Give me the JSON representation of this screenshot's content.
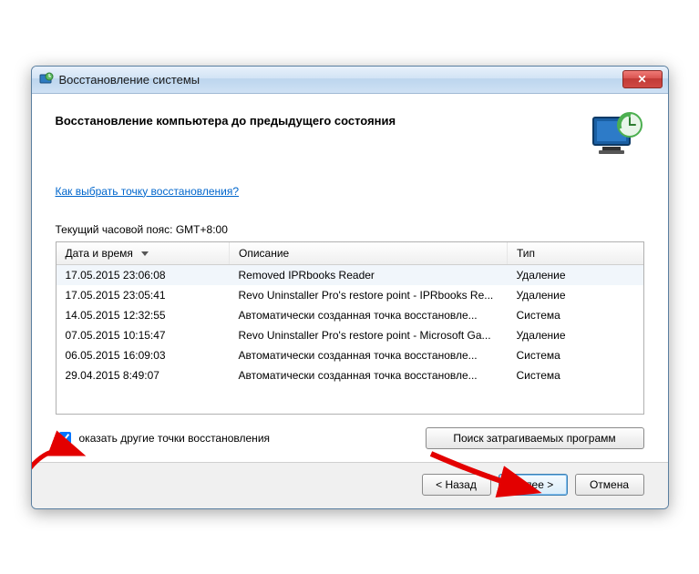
{
  "window": {
    "title": "Восстановление системы"
  },
  "header": {
    "heading": "Восстановление компьютера до предыдущего состояния",
    "help_link": "Как выбрать точку восстановления?",
    "timezone": "Текущий часовой пояс: GMT+8:00"
  },
  "table": {
    "columns": {
      "date": "Дата и время",
      "desc": "Описание",
      "type": "Тип"
    },
    "rows": [
      {
        "date": "17.05.2015 23:06:08",
        "desc": "Removed IPRbooks Reader",
        "type": "Удаление"
      },
      {
        "date": "17.05.2015 23:05:41",
        "desc": "Revo Uninstaller Pro's restore point - IPRbooks Re...",
        "type": "Удаление"
      },
      {
        "date": "14.05.2015 12:32:55",
        "desc": "Автоматически созданная точка восстановле...",
        "type": "Система"
      },
      {
        "date": "07.05.2015 10:15:47",
        "desc": "Revo Uninstaller Pro's restore point - Microsoft Ga...",
        "type": "Удаление"
      },
      {
        "date": "06.05.2015 16:09:03",
        "desc": "Автоматически созданная точка восстановле...",
        "type": "Система"
      },
      {
        "date": "29.04.2015 8:49:07",
        "desc": "Автоматически созданная точка восстановле...",
        "type": "Система"
      }
    ]
  },
  "controls": {
    "show_other_label": "оказать другие точки восстановления",
    "scan_button": "Поиск затрагиваемых программ"
  },
  "footer": {
    "back": "< Назад",
    "next": "Далее >",
    "cancel": "Отмена"
  }
}
